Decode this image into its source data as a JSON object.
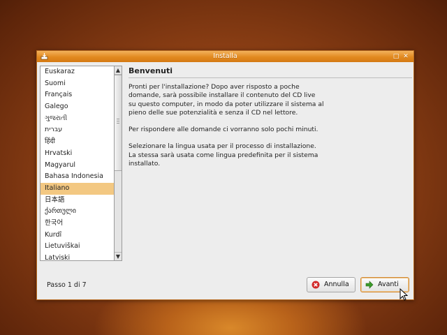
{
  "window": {
    "title": "Installa"
  },
  "languages": {
    "items": [
      "Euskaraz",
      "Suomi",
      "Français",
      "Galego",
      "ગુજરાતી",
      "עברית",
      "हिंदी",
      "Hrvatski",
      "Magyarul",
      "Bahasa Indonesia",
      "Italiano",
      "日本語",
      "ქართული",
      "한국어",
      "Kurdî",
      "Lietuviškai",
      "Latviski"
    ],
    "selected": "Italiano"
  },
  "content": {
    "heading": "Benvenuti",
    "paragraph1": "Pronti per l'installazione? Dopo aver risposto a poche\ndomande, sarà possibile installare il contenuto del CD live\nsu questo computer, in modo da poter utilizzare il sistema al\npieno delle sue potenzialità e senza il CD nel lettore.",
    "paragraph2": "Per rispondere alle domande ci vorranno solo pochi minuti.",
    "paragraph3": "Selezionare la lingua usata per il processo di installazione.\nLa stessa sarà usata come lingua predefinita per il sistema\ninstallato."
  },
  "footer": {
    "step": "Passo 1 di 7",
    "cancel_label": "Annulla",
    "next_label": "Avanti"
  },
  "icons": {
    "cancel": "cancel-circle-icon",
    "next": "green-arrow-right-icon"
  },
  "colors": {
    "titlebar": "#e2891f",
    "selection": "#f3c882",
    "cancel_icon": "#d22a2a",
    "next_icon": "#3a9a2a"
  }
}
